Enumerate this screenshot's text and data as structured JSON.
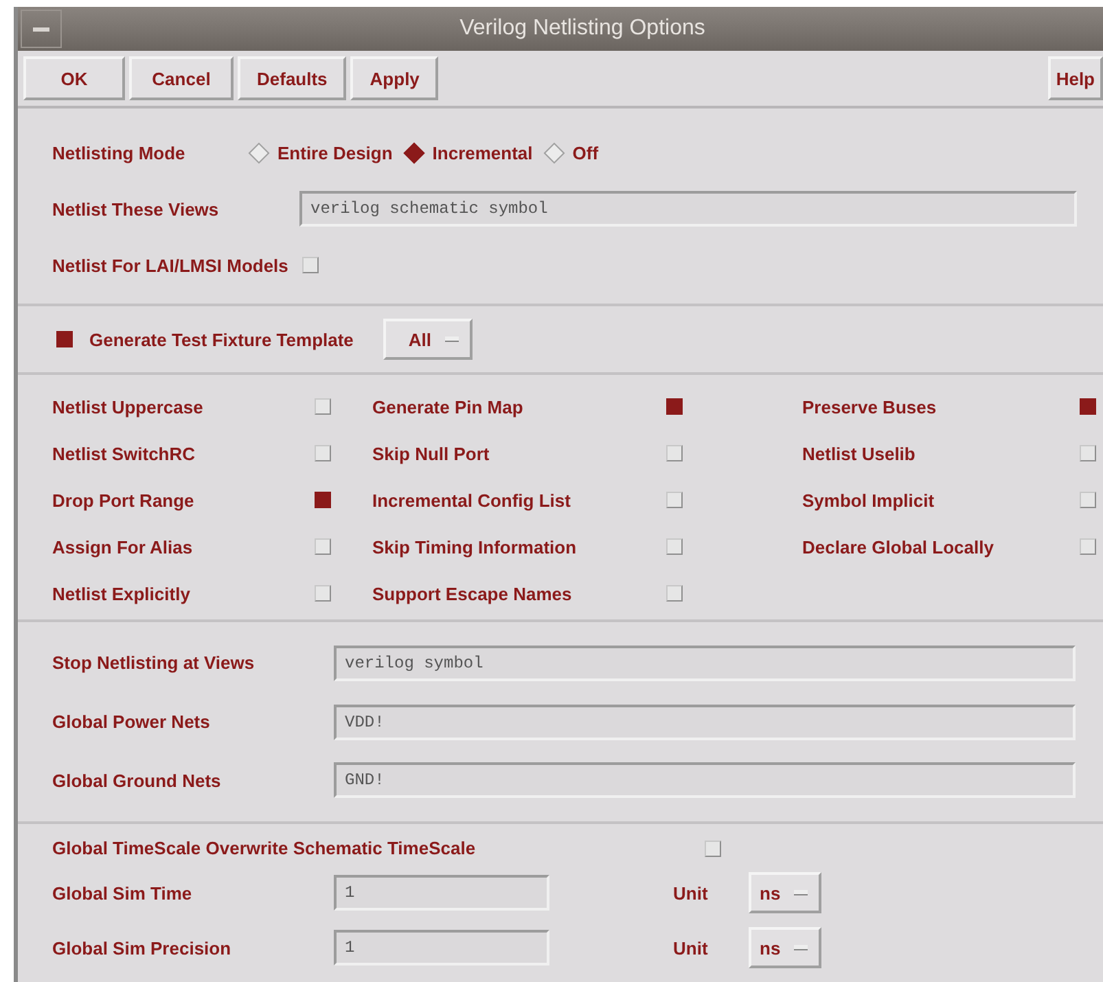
{
  "window": {
    "title": "Verilog Netlisting Options"
  },
  "buttons": [
    {
      "label": "OK"
    },
    {
      "label": "Cancel"
    },
    {
      "label": "Defaults"
    },
    {
      "label": "Apply"
    }
  ],
  "help_button": {
    "label": "Help"
  },
  "netlisting_mode": {
    "label": "Netlisting Mode",
    "options": [
      {
        "label": "Entire Design",
        "selected": false
      },
      {
        "label": "Incremental",
        "selected": true
      },
      {
        "label": "Off",
        "selected": false
      }
    ]
  },
  "netlist_views": {
    "label": "Netlist These Views",
    "value": "verilog schematic symbol"
  },
  "lai_models": {
    "label": "Netlist For LAI/LMSI Models",
    "checked": false
  },
  "test_fixture": {
    "label": "Generate Test Fixture Template",
    "checked": true,
    "dropdown": "All"
  },
  "options": [
    {
      "label": "Netlist Uppercase",
      "checked": false
    },
    {
      "label": "Generate Pin Map",
      "checked": true
    },
    {
      "label": "Preserve Buses",
      "checked": true
    },
    {
      "label": "Netlist SwitchRC",
      "checked": false
    },
    {
      "label": "Skip Null Port",
      "checked": false
    },
    {
      "label": "Netlist Uselib",
      "checked": false
    },
    {
      "label": "Drop Port Range",
      "checked": true
    },
    {
      "label": "Incremental Config List",
      "checked": false
    },
    {
      "label": "Symbol Implicit",
      "checked": false
    },
    {
      "label": "Assign For Alias",
      "checked": false
    },
    {
      "label": "Skip Timing Information",
      "checked": false
    },
    {
      "label": "Declare Global Locally",
      "checked": false
    },
    {
      "label": "Netlist Explicitly",
      "checked": false
    },
    {
      "label": "Support Escape Names",
      "checked": false
    }
  ],
  "net_fields": [
    {
      "label": "Stop Netlisting at Views",
      "value": "verilog symbol"
    },
    {
      "label": "Global Power Nets",
      "value": "VDD!"
    },
    {
      "label": "Global Ground Nets",
      "value": "GND!"
    }
  ],
  "timescale_overwrite": {
    "label": "Global TimeScale Overwrite Schematic TimeScale",
    "checked": false
  },
  "sim_fields": [
    {
      "label": "Global Sim Time",
      "value": "1",
      "unit_label": "Unit",
      "unit": "ns"
    },
    {
      "label": "Global Sim Precision",
      "value": "1",
      "unit_label": "Unit",
      "unit": "ns"
    }
  ]
}
